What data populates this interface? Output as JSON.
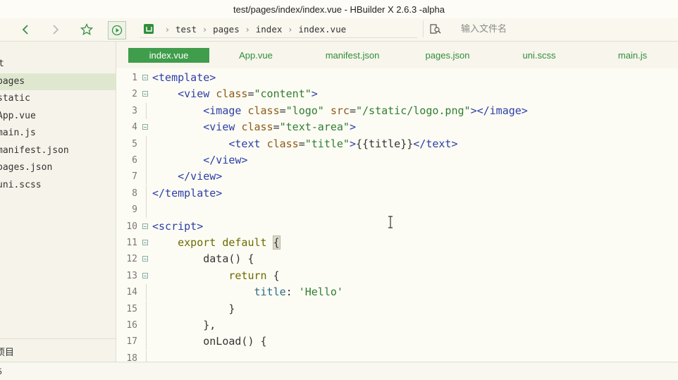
{
  "window": {
    "title": "test/pages/index/index.vue - HBuilder X 2.6.3 -alpha"
  },
  "toolbar": {
    "back_icon": "chevron-left-icon",
    "forward_icon": "chevron-right-icon",
    "favorite_icon": "star-icon",
    "run_icon": "play-circle-icon",
    "breadcrumb": [
      "test",
      "pages",
      "index",
      "index.vue"
    ],
    "search_placeholder": "输入文件名"
  },
  "sidebar": {
    "root_label": "t",
    "items": [
      {
        "label": "pages",
        "selected": true
      },
      {
        "label": "static",
        "selected": false
      },
      {
        "label": "App.vue",
        "selected": false
      },
      {
        "label": "main.js",
        "selected": false
      },
      {
        "label": "manifest.json",
        "selected": false
      },
      {
        "label": "pages.json",
        "selected": false
      },
      {
        "label": "uni.scss",
        "selected": false
      }
    ],
    "footer_label": "项目"
  },
  "tabs": [
    {
      "label": "index.vue",
      "active": true
    },
    {
      "label": "App.vue",
      "active": false
    },
    {
      "label": "manifest.json",
      "active": false
    },
    {
      "label": "pages.json",
      "active": false
    },
    {
      "label": "uni.scss",
      "active": false
    },
    {
      "label": "main.js",
      "active": false
    }
  ],
  "editor": {
    "lines": [
      {
        "n": "1",
        "fold": true,
        "tokens": [
          [
            "t-tag",
            "<template>"
          ]
        ]
      },
      {
        "n": "2",
        "fold": true,
        "tokens": [
          [
            "t-plain",
            "    "
          ],
          [
            "t-tag",
            "<view "
          ],
          [
            "t-attr",
            "class"
          ],
          [
            "t-plain",
            "="
          ],
          [
            "t-str",
            "\"content\""
          ],
          [
            "t-tag",
            ">"
          ]
        ]
      },
      {
        "n": "3",
        "fold": false,
        "tokens": [
          [
            "t-plain",
            "        "
          ],
          [
            "t-tag",
            "<image "
          ],
          [
            "t-attr",
            "class"
          ],
          [
            "t-plain",
            "="
          ],
          [
            "t-str",
            "\"logo\" "
          ],
          [
            "t-attr",
            "src"
          ],
          [
            "t-plain",
            "="
          ],
          [
            "t-str",
            "\"/static/logo.png\""
          ],
          [
            "t-tag",
            "></image>"
          ]
        ]
      },
      {
        "n": "4",
        "fold": true,
        "tokens": [
          [
            "t-plain",
            "        "
          ],
          [
            "t-tag",
            "<view "
          ],
          [
            "t-attr",
            "class"
          ],
          [
            "t-plain",
            "="
          ],
          [
            "t-str",
            "\"text-area\""
          ],
          [
            "t-tag",
            ">"
          ]
        ]
      },
      {
        "n": "5",
        "fold": false,
        "tokens": [
          [
            "t-plain",
            "            "
          ],
          [
            "t-tag",
            "<text "
          ],
          [
            "t-attr",
            "class"
          ],
          [
            "t-plain",
            "="
          ],
          [
            "t-str",
            "\"title\""
          ],
          [
            "t-tag",
            ">"
          ],
          [
            "t-plain",
            "{{title}}"
          ],
          [
            "t-tag",
            "</text>"
          ]
        ]
      },
      {
        "n": "6",
        "fold": false,
        "tokens": [
          [
            "t-plain",
            "        "
          ],
          [
            "t-tag",
            "</view>"
          ]
        ]
      },
      {
        "n": "7",
        "fold": false,
        "tokens": [
          [
            "t-plain",
            "    "
          ],
          [
            "t-tag",
            "</view>"
          ]
        ]
      },
      {
        "n": "8",
        "fold": false,
        "tokens": [
          [
            "t-tag",
            "</template>"
          ]
        ]
      },
      {
        "n": "9",
        "fold": false,
        "tokens": []
      },
      {
        "n": "10",
        "fold": true,
        "tokens": [
          [
            "t-tag",
            "<script>"
          ]
        ]
      },
      {
        "n": "11",
        "fold": true,
        "tokens": [
          [
            "t-plain",
            "    "
          ],
          [
            "t-kw",
            "export default "
          ],
          [
            "hl-brace",
            "{"
          ]
        ]
      },
      {
        "n": "12",
        "fold": true,
        "tokens": [
          [
            "t-plain",
            "        data() {"
          ]
        ]
      },
      {
        "n": "13",
        "fold": true,
        "tokens": [
          [
            "t-plain",
            "            "
          ],
          [
            "t-kw",
            "return"
          ],
          [
            "t-plain",
            " {"
          ]
        ]
      },
      {
        "n": "14",
        "fold": false,
        "tokens": [
          [
            "t-plain",
            "                "
          ],
          [
            "t-key",
            "title"
          ],
          [
            "t-plain",
            ": "
          ],
          [
            "t-str",
            "'Hello'"
          ]
        ]
      },
      {
        "n": "15",
        "fold": false,
        "tokens": [
          [
            "t-plain",
            "            }"
          ]
        ]
      },
      {
        "n": "16",
        "fold": false,
        "tokens": [
          [
            "t-plain",
            "        },"
          ]
        ]
      },
      {
        "n": "17",
        "fold": false,
        "tokens": [
          [
            "t-plain",
            "        onLoad() {"
          ]
        ]
      },
      {
        "n": "18",
        "fold": false,
        "tokens": []
      }
    ]
  },
  "status": {
    "text": "5"
  }
}
